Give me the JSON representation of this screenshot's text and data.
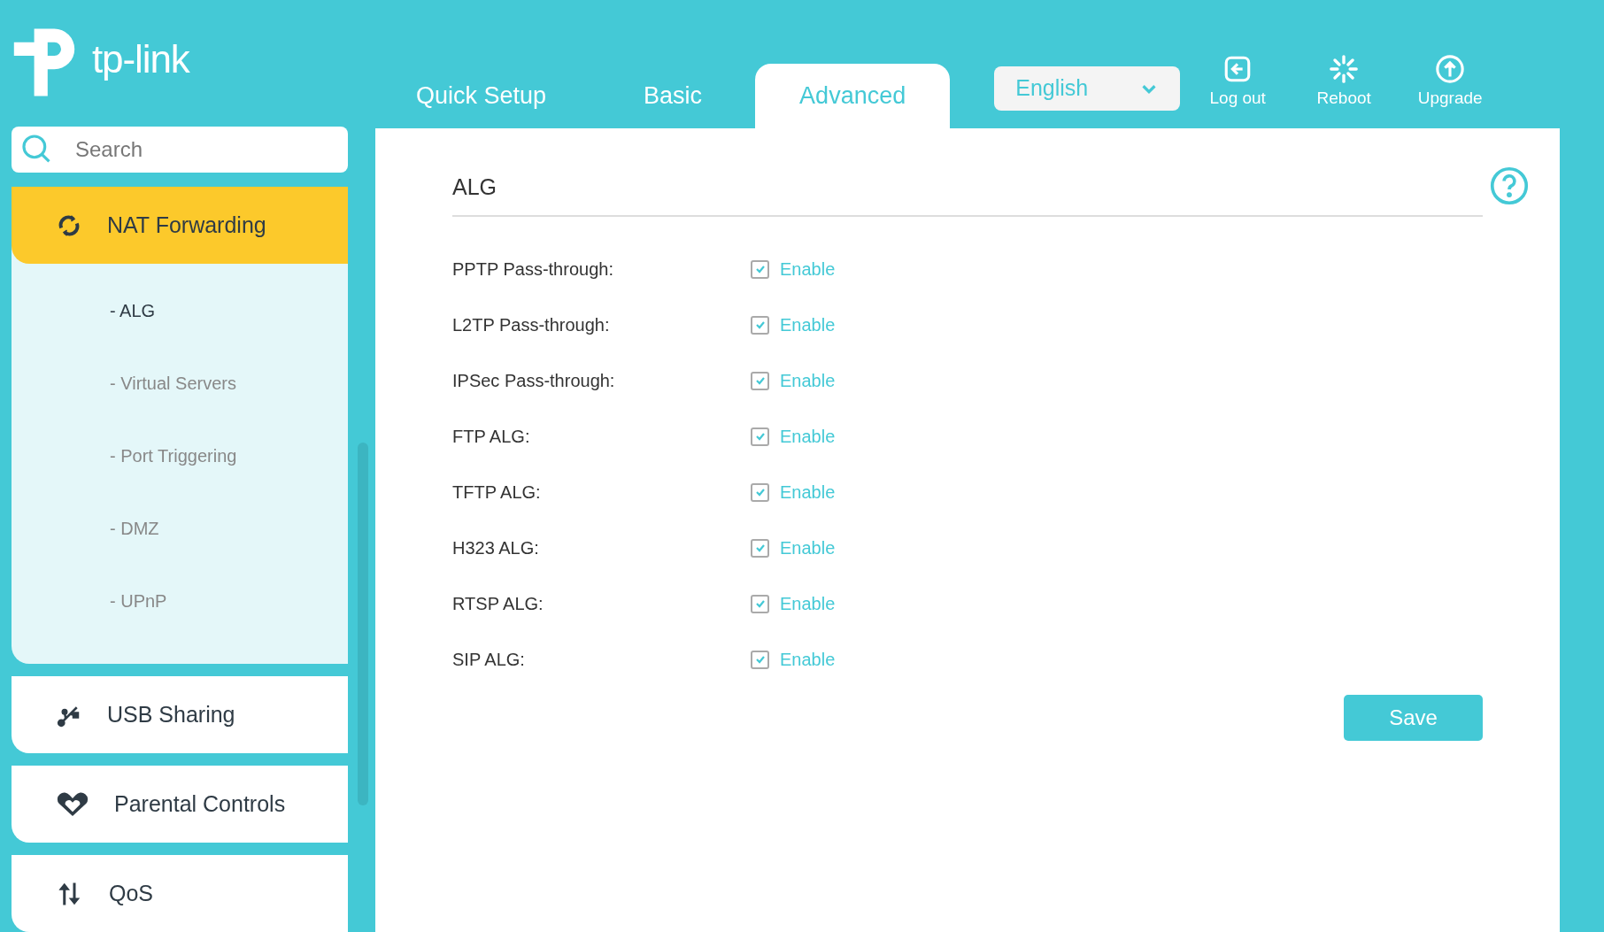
{
  "logo": {
    "text": "tp-link"
  },
  "tabs": [
    {
      "label": "Quick Setup",
      "selected": false
    },
    {
      "label": "Basic",
      "selected": false
    },
    {
      "label": "Advanced",
      "selected": true
    }
  ],
  "language": {
    "value": "English"
  },
  "actions": [
    {
      "label": "Log out"
    },
    {
      "label": "Reboot"
    },
    {
      "label": "Upgrade"
    }
  ],
  "search": {
    "placeholder": "Search"
  },
  "sidebar": {
    "items": [
      {
        "label": "NAT Forwarding",
        "selected": true,
        "expanded": true,
        "children": [
          {
            "label": "- ALG",
            "selected": true
          },
          {
            "label": "- Virtual Servers",
            "selected": false
          },
          {
            "label": "- Port Triggering",
            "selected": false
          },
          {
            "label": "- DMZ",
            "selected": false
          },
          {
            "label": "- UPnP",
            "selected": false
          }
        ]
      },
      {
        "label": "USB Sharing",
        "selected": false,
        "expanded": false
      },
      {
        "label": "Parental Controls",
        "selected": false,
        "expanded": false
      },
      {
        "label": "QoS",
        "selected": false,
        "expanded": false
      }
    ]
  },
  "section": {
    "title": "ALG",
    "rows": [
      {
        "label": "PPTP Pass-through:",
        "option": "Enable",
        "checked": true
      },
      {
        "label": "L2TP Pass-through:",
        "option": "Enable",
        "checked": true
      },
      {
        "label": "IPSec Pass-through:",
        "option": "Enable",
        "checked": true
      },
      {
        "label": "FTP ALG:",
        "option": "Enable",
        "checked": true
      },
      {
        "label": "TFTP ALG:",
        "option": "Enable",
        "checked": true
      },
      {
        "label": "H323 ALG:",
        "option": "Enable",
        "checked": true
      },
      {
        "label": "RTSP ALG:",
        "option": "Enable",
        "checked": true
      },
      {
        "label": "SIP ALG:",
        "option": "Enable",
        "checked": true
      }
    ],
    "save_button": "Save"
  }
}
